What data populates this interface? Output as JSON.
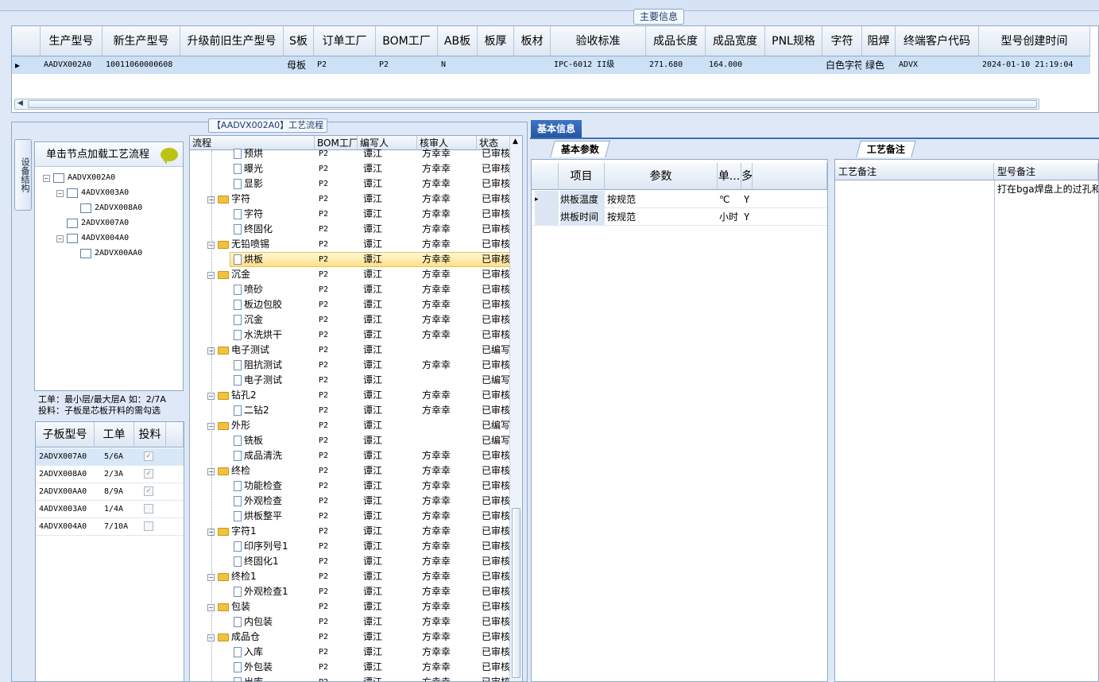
{
  "main_info": {
    "title": "主要信息",
    "columns": [
      "生产型号",
      "新生产型号",
      "升级前旧生产型号",
      "S板",
      "订单工厂",
      "BOM工厂",
      "AB板",
      "板厚",
      "板材",
      "验收标准",
      "成品长度",
      "成品宽度",
      "PNL规格",
      "字符",
      "阻焊",
      "终端客户代码",
      "型号创建时间"
    ],
    "row": [
      "AADVX002A0",
      "10011060000608",
      "",
      "母板",
      "P2",
      "P2",
      "N",
      "",
      "",
      "IPC-6012 II级",
      "271.680",
      "164.000",
      "",
      "白色字符",
      "绿色",
      "ADVX",
      "2024-01-10 21:19:04"
    ]
  },
  "structure": {
    "vtab": "设备结构",
    "tree_header": "单击节点加载工艺流程",
    "tree": [
      {
        "label": "AADVX002A0",
        "level": 0,
        "expander": "−"
      },
      {
        "label": "4ADVX003A0",
        "level": 1,
        "expander": "−"
      },
      {
        "label": "2ADVX008A0",
        "level": 2,
        "expander": ""
      },
      {
        "label": "2ADVX007A0",
        "level": 1,
        "expander": ""
      },
      {
        "label": "4ADVX004A0",
        "level": 1,
        "expander": "−"
      },
      {
        "label": "2ADVX00AA0",
        "level": 2,
        "expander": ""
      }
    ],
    "note_line1": "工单：最小层/最大层A 如：2/7A",
    "note_line2": "投料：子板是芯板开料的需勾选",
    "sub_columns": [
      "子板型号",
      "工单",
      "投料"
    ],
    "sub_rows": [
      {
        "model": "2ADVX007A0",
        "order": "5/6A",
        "feed": true
      },
      {
        "model": "2ADVX008A0",
        "order": "2/3A",
        "feed": true
      },
      {
        "model": "2ADVX00AA0",
        "order": "8/9A",
        "feed": true
      },
      {
        "model": "4ADVX003A0",
        "order": "1/4A",
        "feed": false
      },
      {
        "model": "4ADVX004A0",
        "order": "7/10A",
        "feed": false
      }
    ]
  },
  "process": {
    "title": "【AADVX002A0】工艺流程",
    "columns": [
      "流程",
      "BOM工厂",
      "编写人",
      "核审人",
      "状态"
    ],
    "rows": [
      {
        "name": "预烘",
        "type": "doc",
        "bom": "P2",
        "writer": "谭江",
        "reviewer": "方幸幸",
        "status": "已审核"
      },
      {
        "name": "曝光",
        "type": "doc",
        "bom": "P2",
        "writer": "谭江",
        "reviewer": "方幸幸",
        "status": "已审核"
      },
      {
        "name": "显影",
        "type": "doc",
        "bom": "P2",
        "writer": "谭江",
        "reviewer": "方幸幸",
        "status": "已审核"
      },
      {
        "name": "字符",
        "type": "folder",
        "bom": "P2",
        "writer": "谭江",
        "reviewer": "方幸幸",
        "status": "已审核"
      },
      {
        "name": "字符",
        "type": "doc",
        "bom": "P2",
        "writer": "谭江",
        "reviewer": "方幸幸",
        "status": "已审核"
      },
      {
        "name": "终固化",
        "type": "doc",
        "bom": "P2",
        "writer": "谭江",
        "reviewer": "方幸幸",
        "status": "已审核"
      },
      {
        "name": "无铅喷锡",
        "type": "folder",
        "bom": "P2",
        "writer": "谭江",
        "reviewer": "方幸幸",
        "status": "已审核"
      },
      {
        "name": "烘板",
        "type": "doc",
        "bom": "P2",
        "writer": "谭江",
        "reviewer": "方幸幸",
        "status": "已审核",
        "selected": true
      },
      {
        "name": "沉金",
        "type": "folder",
        "bom": "P2",
        "writer": "谭江",
        "reviewer": "方幸幸",
        "status": "已审核"
      },
      {
        "name": "喷砂",
        "type": "doc",
        "bom": "P2",
        "writer": "谭江",
        "reviewer": "方幸幸",
        "status": "已审核"
      },
      {
        "name": "板边包胶",
        "type": "doc",
        "bom": "P2",
        "writer": "谭江",
        "reviewer": "方幸幸",
        "status": "已审核"
      },
      {
        "name": "沉金",
        "type": "doc",
        "bom": "P2",
        "writer": "谭江",
        "reviewer": "方幸幸",
        "status": "已审核"
      },
      {
        "name": "水洗烘干",
        "type": "doc",
        "bom": "P2",
        "writer": "谭江",
        "reviewer": "方幸幸",
        "status": "已审核"
      },
      {
        "name": "电子测试",
        "type": "folder",
        "bom": "P2",
        "writer": "谭江",
        "reviewer": "",
        "status": "已编写"
      },
      {
        "name": "阻抗测试",
        "type": "doc",
        "bom": "P2",
        "writer": "谭江",
        "reviewer": "方幸幸",
        "status": "已审核"
      },
      {
        "name": "电子测试",
        "type": "doc",
        "bom": "P2",
        "writer": "谭江",
        "reviewer": "",
        "status": "已编写"
      },
      {
        "name": "钻孔2",
        "type": "folder",
        "bom": "P2",
        "writer": "谭江",
        "reviewer": "方幸幸",
        "status": "已审核"
      },
      {
        "name": "二钻2",
        "type": "doc",
        "bom": "P2",
        "writer": "谭江",
        "reviewer": "方幸幸",
        "status": "已审核"
      },
      {
        "name": "外形",
        "type": "folder",
        "bom": "P2",
        "writer": "谭江",
        "reviewer": "",
        "status": "已编写"
      },
      {
        "name": "铣板",
        "type": "doc",
        "bom": "P2",
        "writer": "谭江",
        "reviewer": "",
        "status": "已编写"
      },
      {
        "name": "成品清洗",
        "type": "doc",
        "bom": "P2",
        "writer": "谭江",
        "reviewer": "方幸幸",
        "status": "已审核"
      },
      {
        "name": "终检",
        "type": "folder",
        "bom": "P2",
        "writer": "谭江",
        "reviewer": "方幸幸",
        "status": "已审核"
      },
      {
        "name": "功能检查",
        "type": "doc",
        "bom": "P2",
        "writer": "谭江",
        "reviewer": "方幸幸",
        "status": "已审核"
      },
      {
        "name": "外观检查",
        "type": "doc",
        "bom": "P2",
        "writer": "谭江",
        "reviewer": "方幸幸",
        "status": "已审核"
      },
      {
        "name": "烘板整平",
        "type": "doc",
        "bom": "P2",
        "writer": "谭江",
        "reviewer": "方幸幸",
        "status": "已审核"
      },
      {
        "name": "字符1",
        "type": "folder",
        "bom": "P2",
        "writer": "谭江",
        "reviewer": "方幸幸",
        "status": "已审核"
      },
      {
        "name": "印序列号1",
        "type": "doc",
        "bom": "P2",
        "writer": "谭江",
        "reviewer": "方幸幸",
        "status": "已审核"
      },
      {
        "name": "终固化1",
        "type": "doc",
        "bom": "P2",
        "writer": "谭江",
        "reviewer": "方幸幸",
        "status": "已审核"
      },
      {
        "name": "终检1",
        "type": "folder",
        "bom": "P2",
        "writer": "谭江",
        "reviewer": "方幸幸",
        "status": "已审核"
      },
      {
        "name": "外观检查1",
        "type": "doc",
        "bom": "P2",
        "writer": "谭江",
        "reviewer": "方幸幸",
        "status": "已审核"
      },
      {
        "name": "包装",
        "type": "folder",
        "bom": "P2",
        "writer": "谭江",
        "reviewer": "方幸幸",
        "status": "已审核"
      },
      {
        "name": "内包装",
        "type": "doc",
        "bom": "P2",
        "writer": "谭江",
        "reviewer": "方幸幸",
        "status": "已审核"
      },
      {
        "name": "成品仓",
        "type": "folder",
        "bom": "P2",
        "writer": "谭江",
        "reviewer": "方幸幸",
        "status": "已审核"
      },
      {
        "name": "入库",
        "type": "doc",
        "bom": "P2",
        "writer": "谭江",
        "reviewer": "方幸幸",
        "status": "已审核"
      },
      {
        "name": "外包装",
        "type": "doc",
        "bom": "P2",
        "writer": "谭江",
        "reviewer": "方幸幸",
        "status": "已审核"
      },
      {
        "name": "出库",
        "type": "doc",
        "bom": "P2",
        "writer": "谭江",
        "reviewer": "方幸幸",
        "status": "已审核"
      }
    ]
  },
  "basic_info": {
    "tab": "基本信息",
    "params_tab": "基本参数",
    "param_columns": [
      "项目",
      "参数",
      "单...",
      "多."
    ],
    "params": [
      {
        "item": "烘板温度",
        "value": "按规范",
        "unit": "℃",
        "flag": "Y"
      },
      {
        "item": "烘板时间",
        "value": "按规范",
        "unit": "小时",
        "flag": "Y"
      }
    ],
    "remark_tab": "工艺备注",
    "remark_col1": "工艺备注",
    "remark_col2": "型号备注",
    "model_remark": "打在bga焊盘上的过孔和固"
  },
  "colors": {
    "accent": "#2f64b4",
    "header_bg": "#dde7f3",
    "selected_row": "#cce0f6",
    "highlight": "#ffe089",
    "folder": "#f3c23c"
  }
}
